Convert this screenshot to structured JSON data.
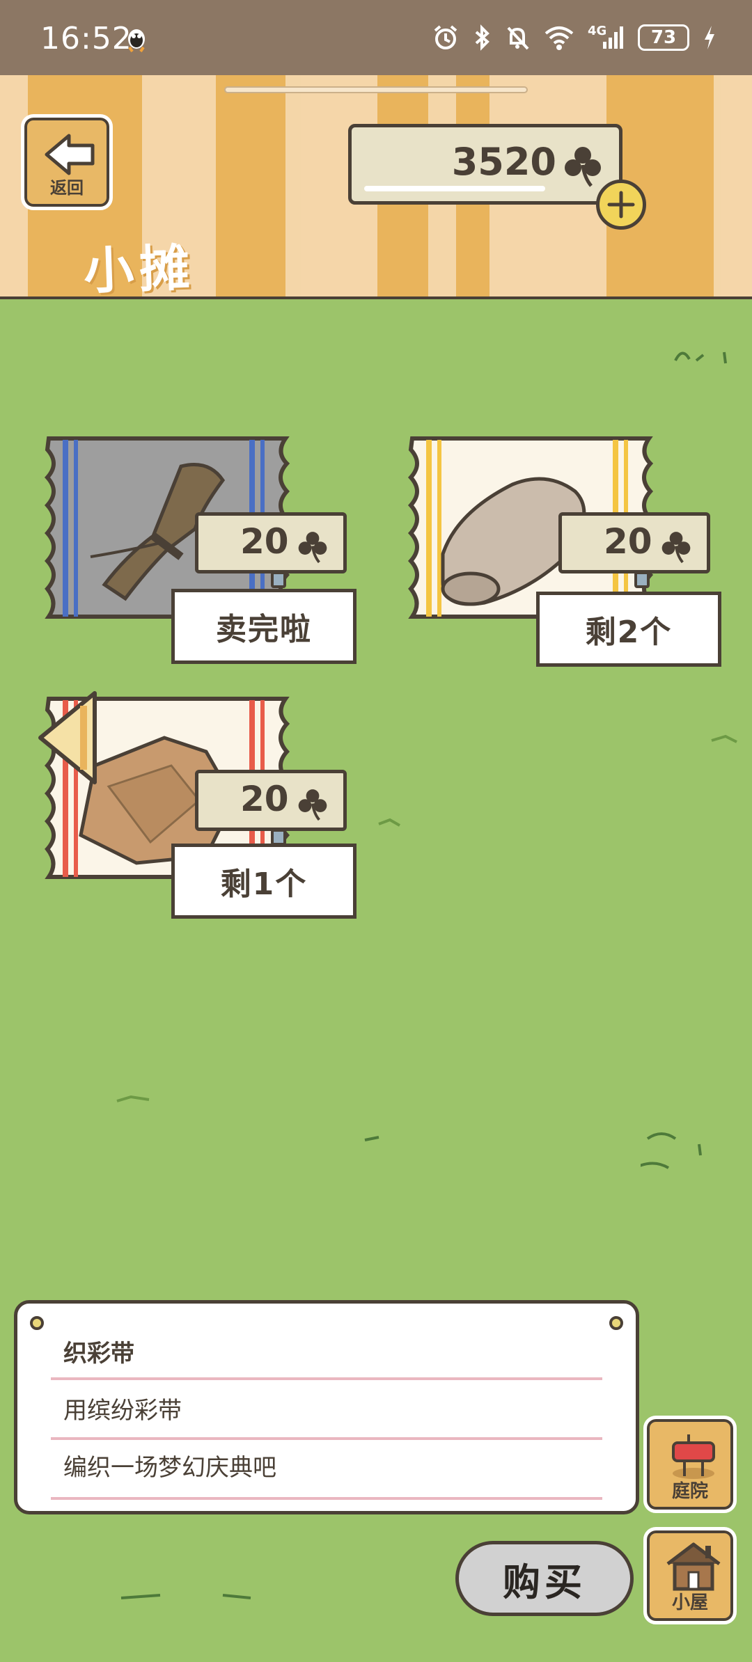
{
  "status_bar": {
    "time": "16:52",
    "battery": "73",
    "signal_label": "4G"
  },
  "header": {
    "back_label": "返回",
    "title": "小摊",
    "currency": "3520"
  },
  "items": [
    {
      "price": "20",
      "status": "卖完啦",
      "rug_color": "#9e9e9e",
      "stripe_color": "#4a6fc4"
    },
    {
      "price": "20",
      "status": "剩2个",
      "rug_color": "#fbf5e8",
      "stripe_color": "#f4c542"
    },
    {
      "price": "20",
      "status": "剩1个",
      "rug_color": "#fbf5e8",
      "stripe_color": "#e85c4a"
    }
  ],
  "description": {
    "title": "织彩带",
    "line1": "用缤纷彩带",
    "line2": "编织一场梦幻庆典吧"
  },
  "side_buttons": {
    "yard_label": "庭院",
    "house_label": "小屋"
  },
  "buy_label": "购买",
  "colors": {
    "grass": "#9cc46a",
    "awning_orange": "#e9b45c",
    "awning_cream": "#f4d6a8",
    "outline": "#4a4036"
  }
}
